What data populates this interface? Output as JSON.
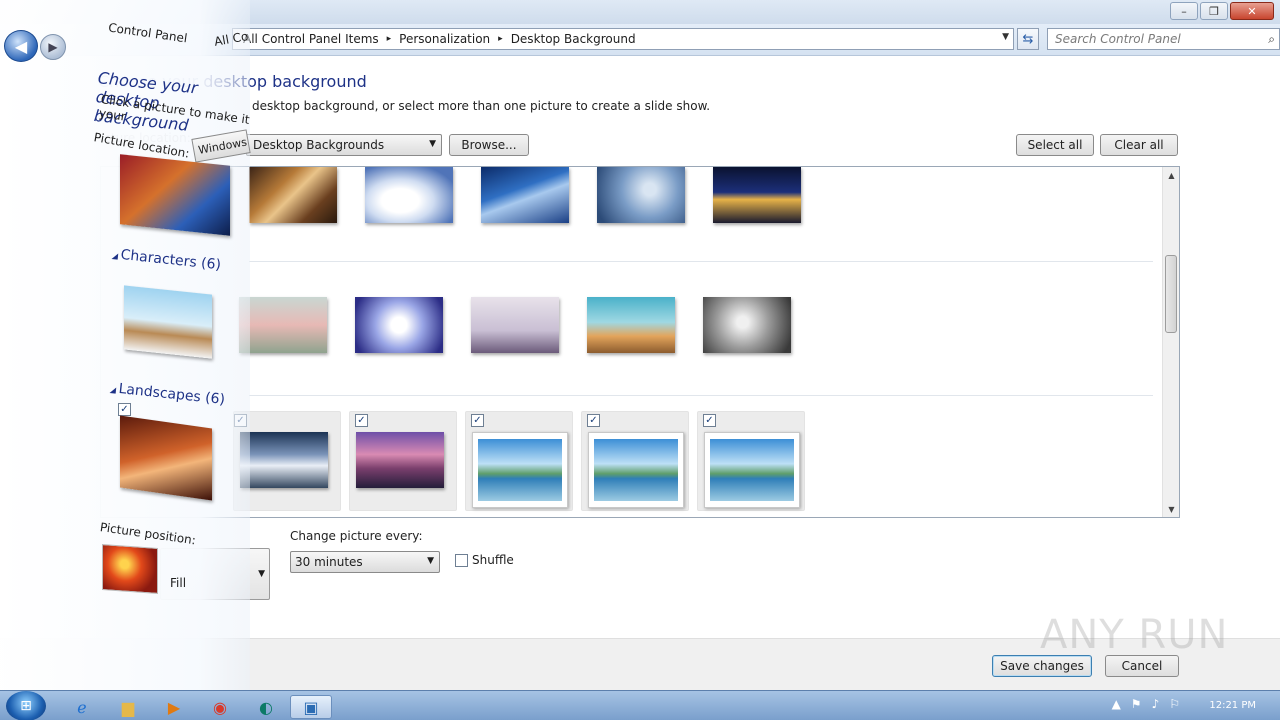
{
  "window": {
    "minimize_glyph": "–",
    "maximize_glyph": "❐",
    "close_glyph": "✕"
  },
  "address": {
    "crumbs": [
      "Control Panel",
      "All Control Panel Items",
      "Personalization",
      "Desktop Background"
    ],
    "search_placeholder": "Search Control Panel"
  },
  "page": {
    "title": "Choose your desktop background",
    "subtitle": "Click a picture to make it your desktop background, or select more than one picture to create a slide show.",
    "subtitle_visible": "desktop background, or select more than one picture to create a slide show.",
    "picture_location_label": "Picture location:",
    "picture_location_value": "Windows Desktop Backgrounds",
    "picture_location_visible": "Desktop Backgrounds",
    "browse_label": "Browse...",
    "select_all_label": "Select all",
    "clear_all_label": "Clear all"
  },
  "gallery": {
    "groups": [
      {
        "name": "Characters (6)"
      },
      {
        "name": "Landscapes (6)"
      }
    ],
    "landscape_checks": [
      "✓",
      "✓",
      "✓",
      "✓",
      "✓",
      "✓"
    ]
  },
  "options": {
    "picture_position_label": "Picture position:",
    "picture_position_value": "Fill",
    "change_every_label": "Change picture every:",
    "change_every_value": "30 minutes",
    "shuffle_label": "Shuffle"
  },
  "footer": {
    "save_label": "Save changes",
    "cancel_label": "Cancel"
  },
  "overlay": {
    "crumb1": "Control Panel",
    "crumb2": "All Co",
    "title": "Choose your desktop background",
    "sub": "Click a picture to make it your",
    "loc": "Picture location:",
    "win_btn": "Windows",
    "chars": "Characters (6)",
    "lands": "Landscapes (6)",
    "pos": "Picture position:",
    "pos_value": "Fill"
  },
  "watermark": "ANY RUN",
  "taskbar": {
    "clock_time": "12:21 PM"
  }
}
